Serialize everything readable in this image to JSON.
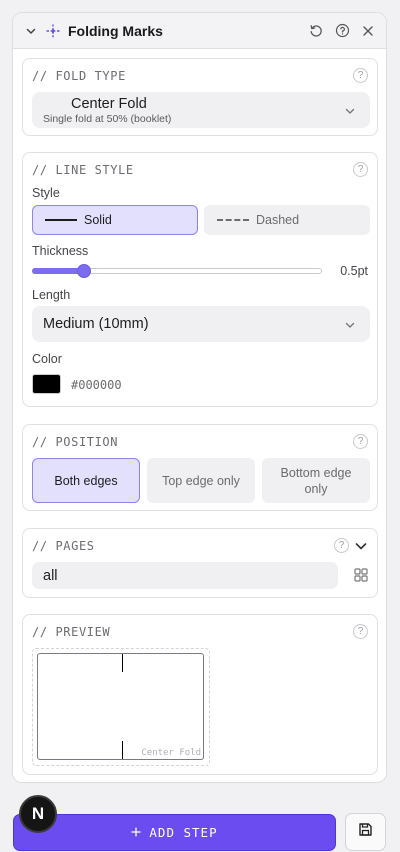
{
  "header": {
    "title": "Folding Marks",
    "icons": [
      "chevron-down-icon",
      "sparkle-icon",
      "reset-icon",
      "help-icon",
      "close-icon"
    ]
  },
  "fold_type": {
    "section_title": "// FOLD TYPE",
    "selected_label": "Center Fold",
    "selected_description": "Single fold at 50% (booklet)"
  },
  "line_style": {
    "section_title": "// LINE STYLE",
    "style_label": "Style",
    "style_options": [
      {
        "label": "Solid",
        "active": true
      },
      {
        "label": "Dashed",
        "active": false
      }
    ],
    "thickness_label": "Thickness",
    "thickness_value": "0.5pt",
    "thickness_fraction": 0.16,
    "length_label": "Length",
    "length_value": "Medium (10mm)",
    "color_label": "Color",
    "color_hex": "#000000"
  },
  "position": {
    "section_title": "// POSITION",
    "options": [
      {
        "label": "Both edges",
        "active": true
      },
      {
        "label": "Top edge only",
        "active": false
      },
      {
        "label": "Bottom edge only",
        "active": false
      }
    ]
  },
  "pages": {
    "section_title": "// PAGES",
    "value": "all"
  },
  "preview": {
    "section_title": "// PREVIEW",
    "caption": "Center Fold"
  },
  "footer": {
    "add_step_label": "ADD STEP",
    "badge_letter": "N"
  },
  "colors": {
    "accent": "#6a4cf0",
    "accent_light": "#e3e0fd",
    "slider": "#7b6cf0"
  }
}
